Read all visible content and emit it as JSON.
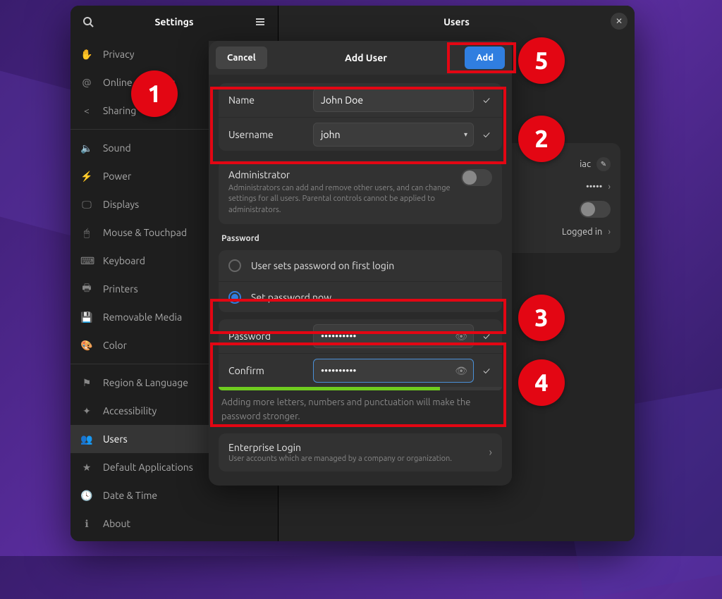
{
  "sidebar": {
    "title": "Settings",
    "items": [
      {
        "icon": "✋",
        "label": "Privacy"
      },
      {
        "icon": "@",
        "label": "Online Accounts"
      },
      {
        "icon": "<",
        "label": "Sharing"
      }
    ],
    "items2": [
      {
        "icon": "🔈",
        "label": "Sound"
      },
      {
        "icon": "⚡",
        "label": "Power"
      },
      {
        "icon": "🖵",
        "label": "Displays"
      },
      {
        "icon": "🖱",
        "label": "Mouse & Touchpad"
      },
      {
        "icon": "⌨",
        "label": "Keyboard"
      },
      {
        "icon": "🖶",
        "label": "Printers"
      },
      {
        "icon": "💾",
        "label": "Removable Media"
      },
      {
        "icon": "🎨",
        "label": "Color"
      }
    ],
    "items3": [
      {
        "icon": "⚑",
        "label": "Region & Language"
      },
      {
        "icon": "✦",
        "label": "Accessibility"
      },
      {
        "icon": "👥",
        "label": "Users",
        "selected": true
      },
      {
        "icon": "★",
        "label": "Default Applications"
      },
      {
        "icon": "🕓",
        "label": "Date & Time"
      },
      {
        "icon": "ℹ",
        "label": "About"
      }
    ]
  },
  "main": {
    "title": "Users",
    "card": {
      "name_suffix": "iac",
      "password_dots": "•••••",
      "status": "Logged in"
    }
  },
  "dialog": {
    "cancel": "Cancel",
    "title": "Add User",
    "add": "Add",
    "name_label": "Name",
    "name_value": "John Doe",
    "username_label": "Username",
    "username_value": "john",
    "admin_title": "Administrator",
    "admin_desc": "Administrators can add and remove other users, and can change settings for all users. Parental controls cannot be applied to administrators.",
    "password_section": "Password",
    "radio_first": "User sets password on first login",
    "radio_now": "Set password now",
    "password_label": "Password",
    "password_value": "••••••••••",
    "confirm_label": "Confirm",
    "confirm_value": "••••••••••",
    "hint": "Adding more letters, numbers and punctuation will make the password stronger.",
    "enterprise_title": "Enterprise Login",
    "enterprise_desc": "User accounts which are managed by a company or organization."
  },
  "badges": [
    "1",
    "2",
    "3",
    "4",
    "5"
  ]
}
